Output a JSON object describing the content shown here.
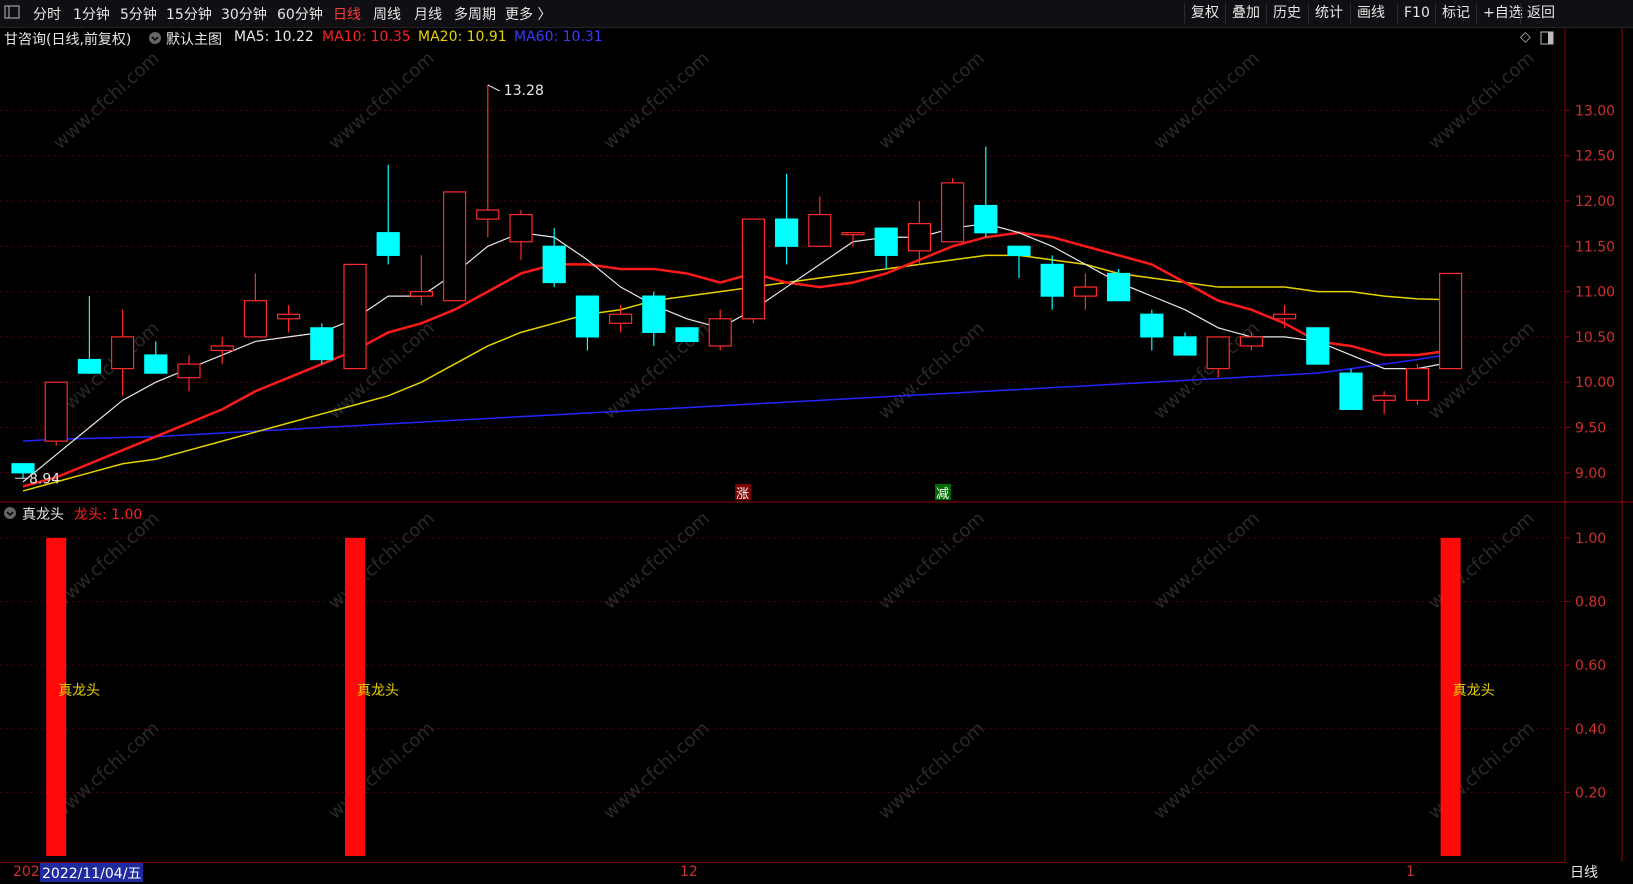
{
  "toolbar": {
    "menu_icon": "window-menu-icon",
    "periods": [
      "分时",
      "1分钟",
      "5分钟",
      "15分钟",
      "30分钟",
      "60分钟",
      "日线",
      "周线",
      "月线",
      "多周期",
      "更多 〉"
    ],
    "active_period": "日线",
    "right_buttons": [
      "复权",
      "叠加",
      "历史",
      "统计",
      "画线",
      "F10",
      "标记",
      "+自选",
      "返回"
    ]
  },
  "info": {
    "title": "甘咨询(日线,前复权)",
    "template": "默认主图",
    "ma5": "MA5: 10.22",
    "ma10": "MA10: 10.35",
    "ma20": "MA20: 10.91",
    "ma60": "MA60: 10.31"
  },
  "colors": {
    "up": "#ff2a2a",
    "down": "#00ffff",
    "ma5": "#e8e8e8",
    "ma10": "#ff1a1a",
    "ma20": "#e6d200",
    "ma60": "#2424ff",
    "grid": "#5a0000",
    "axis_text": "#d0302a"
  },
  "main_axis": {
    "ticks": [
      "13.00",
      "12.50",
      "12.00",
      "11.50",
      "11.00",
      "10.50",
      "10.00",
      "9.50",
      "9.00"
    ],
    "ylim": [
      8.7,
      13.6
    ]
  },
  "annotations": {
    "high": "13.28",
    "low": "8.94",
    "up_marker": "涨",
    "down_marker": "减"
  },
  "indicator": {
    "name": "真龙头",
    "value": "龙头: 1.00",
    "ticks": [
      "1.00",
      "0.80",
      "0.60",
      "0.40",
      "0.20"
    ],
    "bar_label": "真龙头"
  },
  "x_axis": {
    "start_label": "202",
    "cursor_date": "2022/11/04/五",
    "month_label": "12",
    "end_label": "1"
  },
  "period_label": "日线",
  "watermark": "www.cfchi.com",
  "chart_data": {
    "type": "candlestick",
    "candles": [
      [
        9.1,
        9.0,
        9.1,
        8.94
      ],
      [
        9.35,
        10.0,
        10.0,
        9.3
      ],
      [
        10.25,
        10.1,
        10.95,
        10.1
      ],
      [
        10.15,
        10.5,
        10.8,
        9.85
      ],
      [
        10.3,
        10.1,
        10.45,
        10.1
      ],
      [
        10.05,
        10.2,
        10.3,
        9.9
      ],
      [
        10.35,
        10.4,
        10.5,
        10.2
      ],
      [
        10.5,
        10.9,
        11.2,
        10.5
      ],
      [
        10.7,
        10.75,
        10.85,
        10.55
      ],
      [
        10.6,
        10.25,
        10.65,
        10.2
      ],
      [
        10.15,
        11.3,
        11.3,
        10.15
      ],
      [
        11.65,
        11.4,
        12.4,
        11.3
      ],
      [
        10.95,
        11.0,
        11.4,
        10.85
      ],
      [
        10.9,
        12.1,
        12.1,
        10.9
      ],
      [
        11.8,
        11.9,
        13.28,
        11.6
      ],
      [
        11.55,
        11.85,
        11.9,
        11.35
      ],
      [
        11.5,
        11.1,
        11.7,
        11.05
      ],
      [
        10.95,
        10.5,
        10.95,
        10.35
      ],
      [
        10.65,
        10.75,
        10.85,
        10.55
      ],
      [
        10.95,
        10.55,
        11.0,
        10.4
      ],
      [
        10.6,
        10.45,
        10.6,
        10.45
      ],
      [
        10.4,
        10.7,
        10.8,
        10.35
      ],
      [
        10.7,
        11.8,
        11.8,
        10.65
      ],
      [
        11.8,
        11.5,
        12.3,
        11.3
      ],
      [
        11.5,
        11.85,
        12.05,
        11.5
      ],
      [
        11.65,
        11.65,
        11.65,
        11.5
      ],
      [
        11.7,
        11.4,
        11.7,
        11.25
      ],
      [
        11.45,
        11.75,
        12.0,
        11.3
      ],
      [
        11.55,
        12.2,
        12.25,
        11.55
      ],
      [
        11.95,
        11.65,
        12.6,
        11.6
      ],
      [
        11.5,
        11.4,
        11.5,
        11.15
      ],
      [
        11.3,
        10.95,
        11.4,
        10.8
      ],
      [
        10.95,
        11.05,
        11.2,
        10.8
      ],
      [
        11.2,
        10.9,
        11.25,
        10.9
      ],
      [
        10.75,
        10.5,
        10.8,
        10.35
      ],
      [
        10.5,
        10.3,
        10.55,
        10.3
      ],
      [
        10.15,
        10.5,
        10.5,
        10.05
      ],
      [
        10.4,
        10.5,
        10.55,
        10.35
      ],
      [
        10.7,
        10.75,
        10.85,
        10.6
      ],
      [
        10.6,
        10.2,
        10.6,
        10.2
      ],
      [
        10.1,
        9.7,
        10.15,
        9.7
      ],
      [
        9.8,
        9.85,
        9.9,
        9.65
      ],
      [
        9.8,
        10.15,
        10.2,
        9.75
      ],
      [
        10.15,
        11.2,
        11.2,
        10.15
      ]
    ],
    "candle_order": "open,close,high,low",
    "ma5": [
      8.9,
      9.2,
      9.5,
      9.8,
      10.0,
      10.15,
      10.3,
      10.45,
      10.5,
      10.55,
      10.7,
      10.95,
      10.95,
      11.2,
      11.5,
      11.65,
      11.6,
      11.35,
      11.05,
      10.85,
      10.7,
      10.6,
      10.8,
      11.05,
      11.3,
      11.55,
      11.6,
      11.6,
      11.7,
      11.75,
      11.65,
      11.5,
      11.3,
      11.1,
      10.95,
      10.8,
      10.6,
      10.5,
      10.5,
      10.45,
      10.3,
      10.15,
      10.15,
      10.22
    ],
    "ma10": [
      8.85,
      8.95,
      9.1,
      9.25,
      9.4,
      9.55,
      9.7,
      9.9,
      10.05,
      10.2,
      10.35,
      10.55,
      10.65,
      10.8,
      11.0,
      11.2,
      11.3,
      11.3,
      11.25,
      11.25,
      11.2,
      11.1,
      11.2,
      11.1,
      11.05,
      11.1,
      11.2,
      11.35,
      11.5,
      11.6,
      11.65,
      11.6,
      11.5,
      11.4,
      11.3,
      11.1,
      10.9,
      10.8,
      10.65,
      10.45,
      10.4,
      10.3,
      10.3,
      10.35
    ],
    "ma20": [
      8.8,
      8.9,
      9.0,
      9.1,
      9.15,
      9.25,
      9.35,
      9.45,
      9.55,
      9.65,
      9.75,
      9.85,
      10.0,
      10.2,
      10.4,
      10.55,
      10.65,
      10.75,
      10.8,
      10.9,
      10.95,
      11.0,
      11.05,
      11.1,
      11.15,
      11.2,
      11.25,
      11.3,
      11.35,
      11.4,
      11.4,
      11.35,
      11.3,
      11.2,
      11.15,
      11.1,
      11.05,
      11.05,
      11.05,
      11.0,
      11.0,
      10.95,
      10.92,
      10.91
    ],
    "ma60": [
      9.35,
      9.37,
      9.38,
      9.39,
      9.4,
      9.42,
      9.44,
      9.46,
      9.48,
      9.5,
      9.52,
      9.54,
      9.56,
      9.58,
      9.6,
      9.62,
      9.64,
      9.66,
      9.68,
      9.7,
      9.72,
      9.74,
      9.76,
      9.78,
      9.8,
      9.82,
      9.84,
      9.86,
      9.88,
      9.9,
      9.92,
      9.94,
      9.96,
      9.98,
      10.0,
      10.02,
      10.04,
      10.06,
      10.08,
      10.1,
      10.15,
      10.2,
      10.25,
      10.31
    ],
    "signal_bars": [
      1,
      10,
      43
    ],
    "signal_value": 1.0
  }
}
